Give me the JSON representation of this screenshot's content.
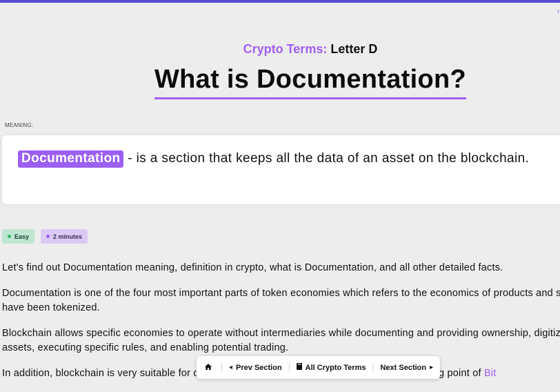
{
  "header": {
    "subtitle_accent": "Crypto Terms:",
    "subtitle_letter": "Letter D",
    "title": "What is Documentation?"
  },
  "meaning": {
    "label": "MEANING:",
    "term": "Documentation",
    "definition": "- is a section that keeps all the data of an asset on the blockchain."
  },
  "badges": {
    "difficulty": "Easy",
    "read_time": "2 minutes"
  },
  "body": {
    "p1": "Let's find out Documentation meaning, definition in crypto, what is Documentation, and all other detailed facts.",
    "p2": "Documentation is one of the four most important parts of token economies which refers to the economics of products and ser have been tokenized.",
    "p3": "Blockchain allows specific economies to operate without intermediaries while documenting and providing ownership, digitizin assets, executing specific rules, and enabling potential trading.",
    "p4_start": "In addition, blockchain is very suitable for d",
    "p4_end": "tion is the starting point of",
    "p4_link": "Bit"
  },
  "nav": {
    "home_icon": "home-icon",
    "prev_label": "Prev Section",
    "all_label": "All Crypto Terms",
    "next_label": "Next Section"
  },
  "colors": {
    "accent": "#a25ff0",
    "top_bar": "#5b4ccf",
    "easy_badge": "#bfe6d2",
    "time_badge": "#dcc9f4"
  }
}
